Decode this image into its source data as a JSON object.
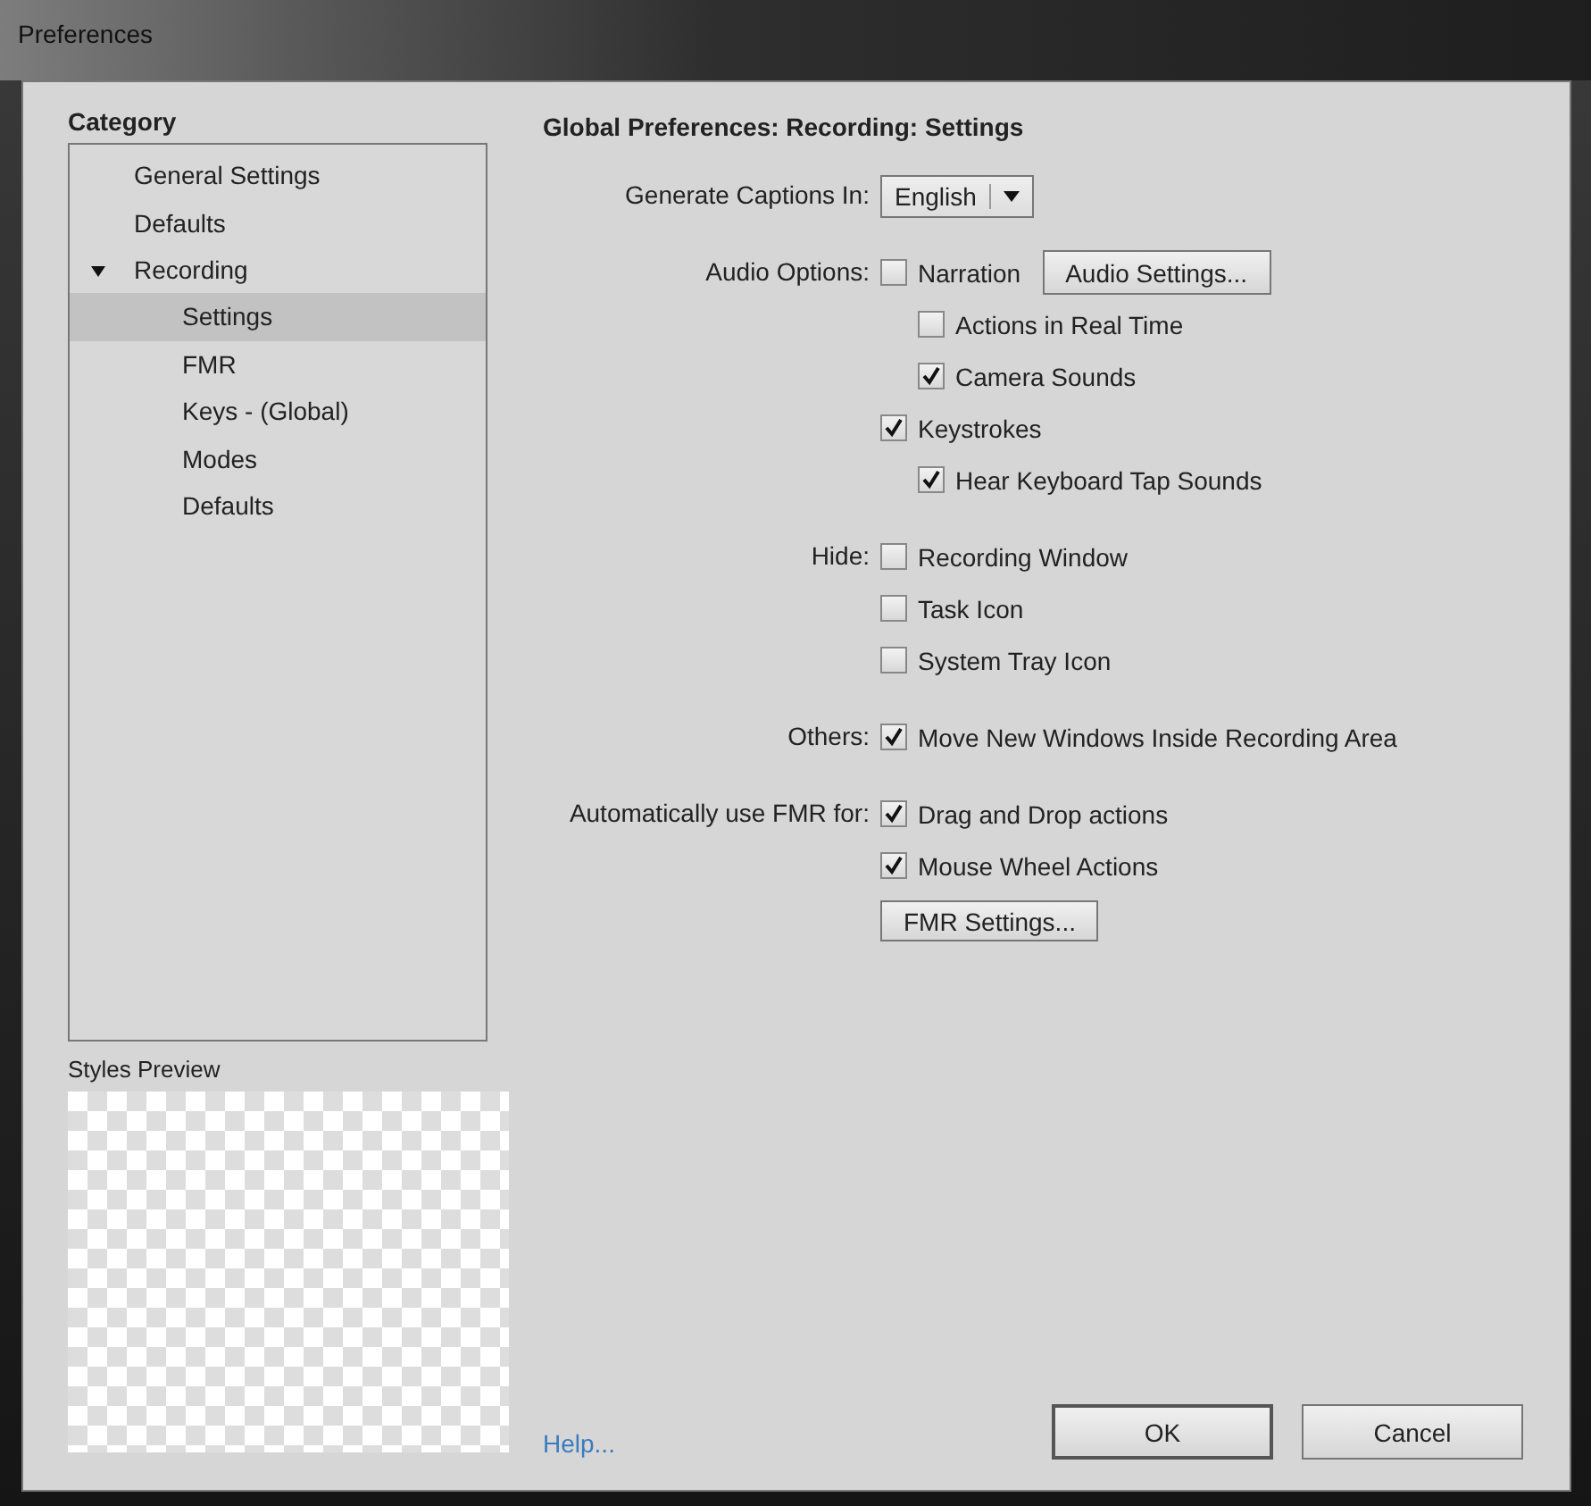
{
  "window": {
    "title": "Preferences"
  },
  "category": {
    "heading": "Category",
    "items": [
      {
        "label": "General Settings",
        "selected": false
      },
      {
        "label": "Defaults",
        "selected": false
      },
      {
        "label": "Recording",
        "selected": false,
        "expanded": true,
        "children": [
          {
            "label": "Settings",
            "selected": true
          },
          {
            "label": "FMR",
            "selected": false
          },
          {
            "label": "Keys - (Global)",
            "selected": false
          },
          {
            "label": "Modes",
            "selected": false
          },
          {
            "label": "Defaults",
            "selected": false
          }
        ]
      }
    ]
  },
  "styles_preview": {
    "label": "Styles Preview"
  },
  "panel": {
    "title": "Global Preferences: Recording: Settings",
    "sections": [
      {
        "label": "Generate Captions In:",
        "options": [
          {
            "kind": "dropdown",
            "value": "English"
          }
        ]
      },
      {
        "label": "Audio Options:",
        "options": [
          {
            "kind": "checkbox",
            "label": "Narration",
            "checked": false,
            "button": "Audio Settings...",
            "children": [
              {
                "kind": "checkbox",
                "label": "Actions in Real Time",
                "checked": false
              },
              {
                "kind": "checkbox",
                "label": "Camera Sounds",
                "checked": true
              }
            ]
          },
          {
            "kind": "checkbox",
            "label": "Keystrokes",
            "checked": true,
            "children": [
              {
                "kind": "checkbox",
                "label": "Hear Keyboard Tap Sounds",
                "checked": true
              }
            ]
          }
        ]
      },
      {
        "label": "Hide:",
        "options": [
          {
            "kind": "checkbox",
            "label": "Recording Window",
            "checked": false
          },
          {
            "kind": "checkbox",
            "label": "Task Icon",
            "checked": false
          },
          {
            "kind": "checkbox",
            "label": "System Tray Icon",
            "checked": false
          }
        ]
      },
      {
        "label": "Others:",
        "options": [
          {
            "kind": "checkbox",
            "label": "Move New Windows Inside Recording Area",
            "checked": true
          }
        ]
      },
      {
        "label": "Automatically use FMR for:",
        "options": [
          {
            "kind": "checkbox",
            "label": "Drag and Drop actions",
            "checked": true
          },
          {
            "kind": "checkbox",
            "label": "Mouse Wheel Actions",
            "checked": true
          },
          {
            "kind": "button",
            "label": "FMR Settings..."
          }
        ]
      }
    ]
  },
  "help_link": "Help...",
  "buttons": [
    {
      "label": "OK",
      "default": true
    },
    {
      "label": "Cancel",
      "default": false
    }
  ]
}
